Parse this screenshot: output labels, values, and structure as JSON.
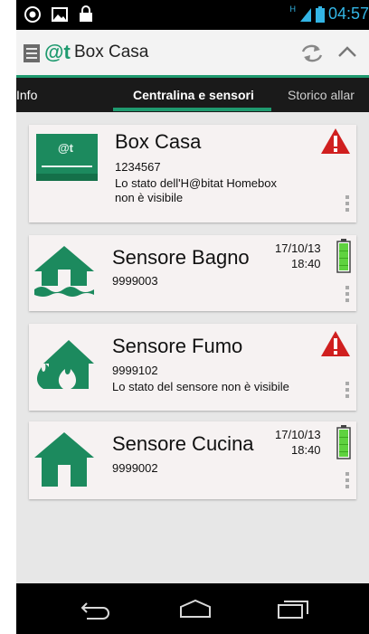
{
  "status_bar": {
    "time": "04:57",
    "network_label": "H",
    "icons": [
      "camera-icon",
      "image-icon",
      "lock-icon",
      "signal-icon",
      "battery-icon"
    ]
  },
  "action_bar": {
    "title": "Box Casa",
    "logo_text": "@t",
    "icons": [
      "menu-icon",
      "habitat-logo-icon",
      "refresh-icon",
      "collapse-icon"
    ]
  },
  "tabs": [
    {
      "label": "Info"
    },
    {
      "label": "Centralina e sensori",
      "active": true
    },
    {
      "label": "Storico allar"
    }
  ],
  "items": [
    {
      "title": "Box Casa",
      "code": "1234567",
      "message": "Lo stato dell'H@bitat Homebox non è visibile",
      "icon": "homebox-icon",
      "status_icon": "warning-icon"
    },
    {
      "title": "Sensore Bagno",
      "code": "9999003",
      "date": "17/10/13",
      "time": "18:40",
      "icon": "house-flood-icon",
      "status_icon": "battery-full-icon"
    },
    {
      "title": "Sensore Fumo",
      "code": "9999102",
      "message": "Lo stato del sensore non è visibile",
      "icon": "house-fire-icon",
      "status_icon": "warning-icon"
    },
    {
      "title": "Sensore Cucina",
      "code": "9999002",
      "date": "17/10/13",
      "time": "18:40",
      "icon": "house-icon",
      "status_icon": "battery-full-icon"
    }
  ],
  "nav_bar": {
    "icons": [
      "back-icon",
      "home-icon",
      "recent-apps-icon"
    ]
  },
  "colors": {
    "accent": "#1f9a6f",
    "icon_green": "#1c8a5e",
    "warning_red": "#d01f1f",
    "battery_green": "#5fd23f",
    "time_blue": "#33b5e5"
  }
}
